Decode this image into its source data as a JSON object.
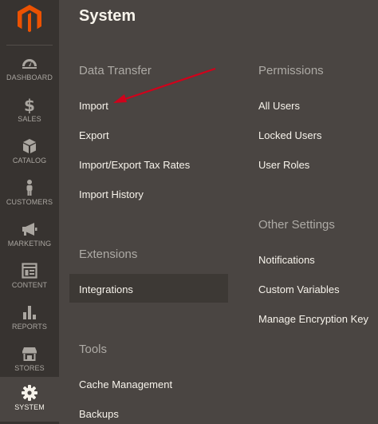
{
  "app": {
    "title": "System"
  },
  "brand": {
    "accent": "#eb5202",
    "rail_bg": "#373330",
    "panel_bg": "#4a4542"
  },
  "nav": {
    "items": [
      {
        "label": "DASHBOARD",
        "icon": "dashboard-icon"
      },
      {
        "label": "SALES",
        "icon": "dollar-icon"
      },
      {
        "label": "CATALOG",
        "icon": "box-icon"
      },
      {
        "label": "CUSTOMERS",
        "icon": "person-icon"
      },
      {
        "label": "MARKETING",
        "icon": "megaphone-icon"
      },
      {
        "label": "CONTENT",
        "icon": "layout-icon"
      },
      {
        "label": "REPORTS",
        "icon": "bar-chart-icon"
      },
      {
        "label": "STORES",
        "icon": "storefront-icon"
      },
      {
        "label": "SYSTEM",
        "icon": "gear-icon",
        "active": true
      }
    ]
  },
  "sections": {
    "data_transfer": {
      "title": "Data Transfer",
      "links": [
        "Import",
        "Export",
        "Import/Export Tax Rates",
        "Import History"
      ]
    },
    "extensions": {
      "title": "Extensions",
      "links": [
        "Integrations"
      ]
    },
    "tools": {
      "title": "Tools",
      "links": [
        "Cache Management",
        "Backups"
      ]
    },
    "permissions": {
      "title": "Permissions",
      "links": [
        "All Users",
        "Locked Users",
        "User Roles"
      ]
    },
    "other_settings": {
      "title": "Other Settings",
      "links": [
        "Notifications",
        "Custom Variables",
        "Manage Encryption Key"
      ]
    }
  },
  "annotation": {
    "arrow_color": "#d0021b"
  }
}
